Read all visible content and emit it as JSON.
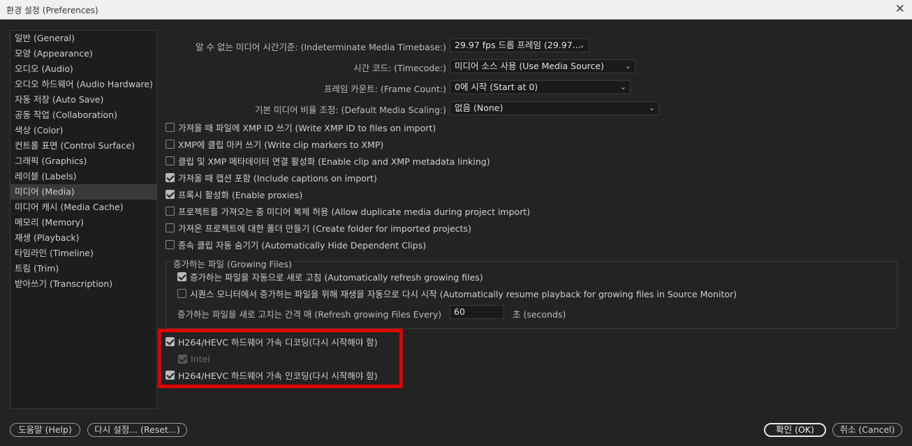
{
  "window": {
    "title": "환경 설정 (Preferences)",
    "close_glyph": "✕"
  },
  "sidebar": {
    "items": [
      {
        "label": "일반 (General)"
      },
      {
        "label": "모양 (Appearance)"
      },
      {
        "label": "오디오 (Audio)"
      },
      {
        "label": "오디오 하드웨어 (Audio Hardware)"
      },
      {
        "label": "자동 저장 (Auto Save)"
      },
      {
        "label": "공동 작업 (Collaboration)"
      },
      {
        "label": "색상 (Color)"
      },
      {
        "label": "컨트롤 표면 (Control Surface)"
      },
      {
        "label": "그래픽 (Graphics)"
      },
      {
        "label": "레이블 (Labels)"
      },
      {
        "label": "미디어 (Media)",
        "selected": true
      },
      {
        "label": "미디어 캐시 (Media Cache)"
      },
      {
        "label": "메모리 (Memory)"
      },
      {
        "label": "재생 (Playback)"
      },
      {
        "label": "타임라인 (Timeline)"
      },
      {
        "label": "트림 (Trim)"
      },
      {
        "label": "받아쓰기 (Transcription)"
      }
    ]
  },
  "media": {
    "timebase": {
      "label": "알 수 없는 미디어 시간기준: (Indeterminate Media Timebase:)",
      "value": "29.97 fps 드롭 프레임 (29.97..."
    },
    "timecode": {
      "label": "시간 코드: (Timecode:)",
      "value": "미디어 소스 사용 (Use Media Source)"
    },
    "frame_count": {
      "label": "프레임 카운트: (Frame Count:)",
      "value": "0에 시작 (Start at 0)"
    },
    "scaling": {
      "label": "기본 미디어 비율 조정: (Default Media Scaling:)",
      "value": "없음 (None)"
    },
    "checkboxes": [
      {
        "label": "가져올 때 파일에 XMP ID 쓰기 (Write XMP ID to files on import)",
        "checked": false
      },
      {
        "label": "XMP에 클립 마커 쓰기 (Write clip markers to XMP)",
        "checked": false
      },
      {
        "label": "클립 및 XMP 메타데이터 연결 활성화 (Enable clip and XMP metadata linking)",
        "checked": false
      },
      {
        "label": "가져올 때 캡션 포함 (Include captions on import)",
        "checked": true
      },
      {
        "label": "프록시 활성화 (Enable proxies)",
        "checked": true
      },
      {
        "label": "프로젝트를 가져오는 중 미디어 복제 허용 (Allow duplicate media during project import)",
        "checked": false
      },
      {
        "label": "가져온 프로젝트에 대한 폴더 만들기 (Create folder for imported projects)",
        "checked": false
      },
      {
        "label": "종속 클립 자동 숨기기 (Automatically Hide Dependent Clips)",
        "checked": false
      }
    ],
    "growing_files": {
      "title": "증가하는 파일 (Growing Files)",
      "refresh": {
        "label": "증가하는 파일을 자동으로 새로 고침 (Automatically refresh growing files)",
        "checked": true
      },
      "resume": {
        "label": "시퀀스 모니터에서 증가하는 파일을 위해 재생을 자동으로 다시 시작 (Automatically resume playback for growing files in Source Monitor)",
        "checked": false
      },
      "interval_label": "증가하는 파일을 새로 고치는 간격 매 (Refresh growing Files Every)",
      "interval_value": "60",
      "interval_unit": "초 (seconds)"
    },
    "hw_decode": {
      "label": "H264/HEVC 하드웨어 가속 디코딩(다시 시작해야 함)",
      "checked": true
    },
    "intel": {
      "label": "Intel",
      "checked": true
    },
    "hw_encode": {
      "label": "H264/HEVC 하드웨어 가속 인코딩(다시 시작해야 함)",
      "checked": true
    }
  },
  "footer": {
    "help": "도움말 (Help)",
    "reset": "다시 설정... (Reset...)",
    "ok": "확인 (OK)",
    "cancel": "취소 (Cancel)"
  },
  "icons": {
    "dropdown": "chevron-down-icon",
    "chevron_glyph": "⌄"
  },
  "colors": {
    "highlight": "#e00000",
    "background": "#232323"
  }
}
